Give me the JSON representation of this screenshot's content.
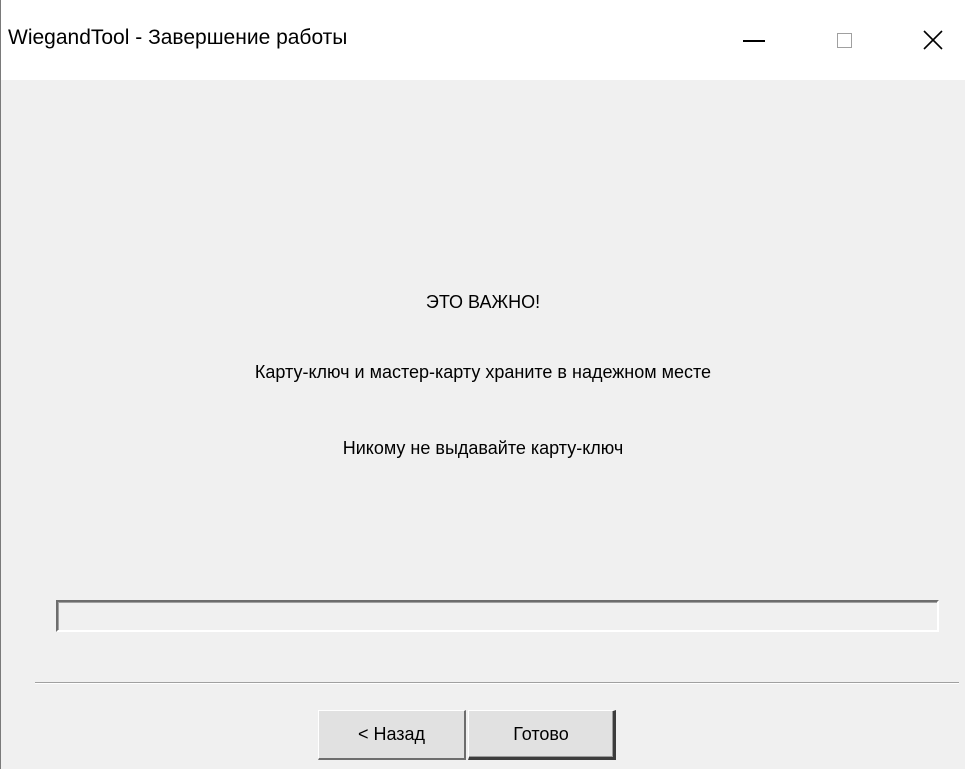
{
  "window": {
    "title": "WiegandTool - Завершение работы"
  },
  "message": {
    "heading": "ЭТО ВАЖНО!",
    "line1": "Карту-ключ и мастер-карту храните в надежном месте",
    "line2": "Никому не выдавайте карту-ключ"
  },
  "progress": {
    "value_percent": 0
  },
  "buttons": {
    "back_label": "< Назад",
    "finish_label": "Готово"
  },
  "titlebar_icons": [
    "minimize-icon",
    "maximize-icon",
    "close-icon"
  ],
  "colors": {
    "titlebar_bg": "#ffffff",
    "dialog_bg": "#f0f0f0",
    "button_bg": "#e1e1e1"
  }
}
